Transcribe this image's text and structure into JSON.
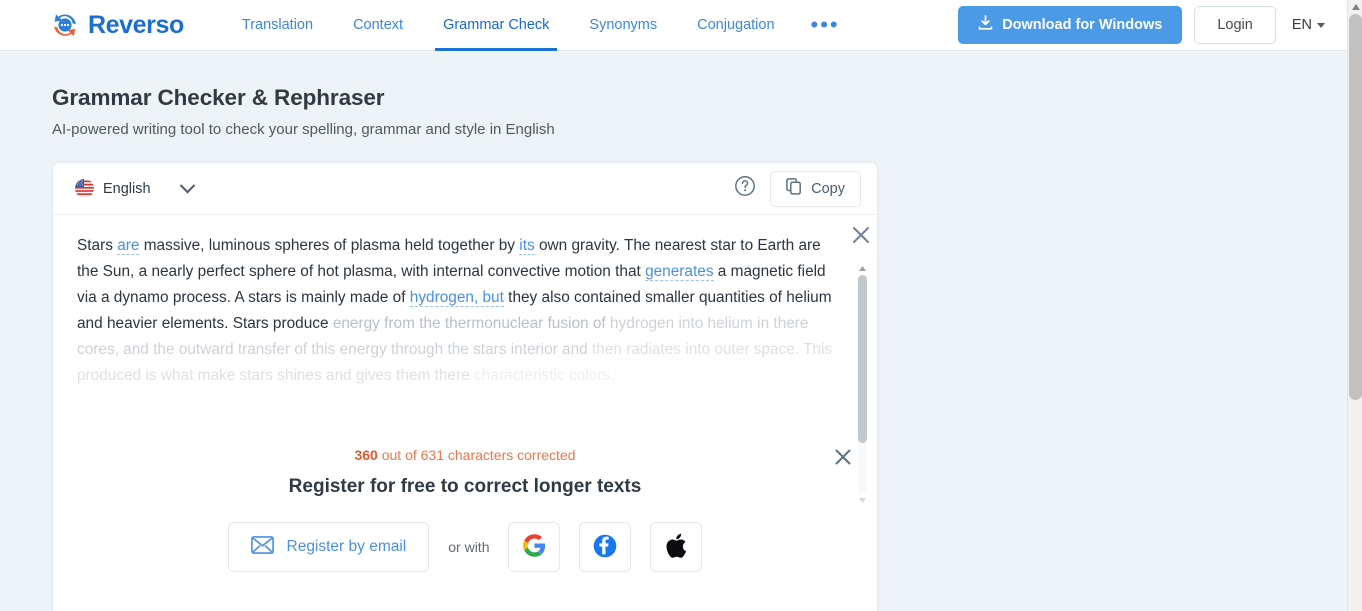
{
  "header": {
    "brand": "Reverso",
    "nav": [
      {
        "label": "Translation",
        "active": false
      },
      {
        "label": "Context",
        "active": false
      },
      {
        "label": "Grammar Check",
        "active": true
      },
      {
        "label": "Synonyms",
        "active": false
      },
      {
        "label": "Conjugation",
        "active": false
      }
    ],
    "more_label": "•••",
    "download_label": "Download for Windows",
    "login_label": "Login",
    "language_label": "EN"
  },
  "page": {
    "title": "Grammar Checker & Rephraser",
    "subtitle": "AI-powered writing tool to check your spelling, grammar and style in English"
  },
  "card": {
    "language": "English",
    "copy_label": "Copy"
  },
  "editor": {
    "segments": [
      {
        "text": "Stars ",
        "style": "normal"
      },
      {
        "text": "are",
        "style": "suggestion"
      },
      {
        "text": " massive, luminous spheres of plasma held together by ",
        "style": "normal"
      },
      {
        "text": "its",
        "style": "suggestion"
      },
      {
        "text": " own gravity. The nearest star to Earth are the Sun, a nearly perfect sphere of hot plasma, with internal convective motion that ",
        "style": "normal"
      },
      {
        "text": "generates",
        "style": "suggestion"
      },
      {
        "text": " a magnetic field via a dynamo process. A stars is mainly made of ",
        "style": "normal"
      },
      {
        "text": "hydrogen, but",
        "style": "suggestion"
      },
      {
        "text": " they also contained smaller quantities of helium and heavier elements. Stars produce ",
        "style": "normal"
      },
      {
        "text": "energy from the thermonuclear fusion of ",
        "style": "fade1"
      },
      {
        "text": "hydrogen into helium in there cores, and the outward transfer of this energy through the stars interior and ",
        "style": "fade2"
      },
      {
        "text": "then radiates into outer space. This produced is what make stars shines and gives them there ",
        "style": "fade3"
      },
      {
        "text": "characteristic colors.",
        "style": "fade4"
      }
    ]
  },
  "banner": {
    "count_corrected": "360",
    "count_rest": " out of 631 characters corrected",
    "title": "Register for free to correct longer texts",
    "email_label": "Register by email",
    "or_with_label": "or with",
    "social": [
      {
        "name": "google",
        "label": "G"
      },
      {
        "name": "facebook",
        "label": "f"
      },
      {
        "name": "apple",
        "label": ""
      }
    ]
  },
  "colors": {
    "brand_blue": "#1c6fd0",
    "accent_blue": "#4a9ae8",
    "suggestion_blue": "#4b90e2",
    "warning_orange": "#e8582a",
    "page_bg": "#eef3f7"
  }
}
